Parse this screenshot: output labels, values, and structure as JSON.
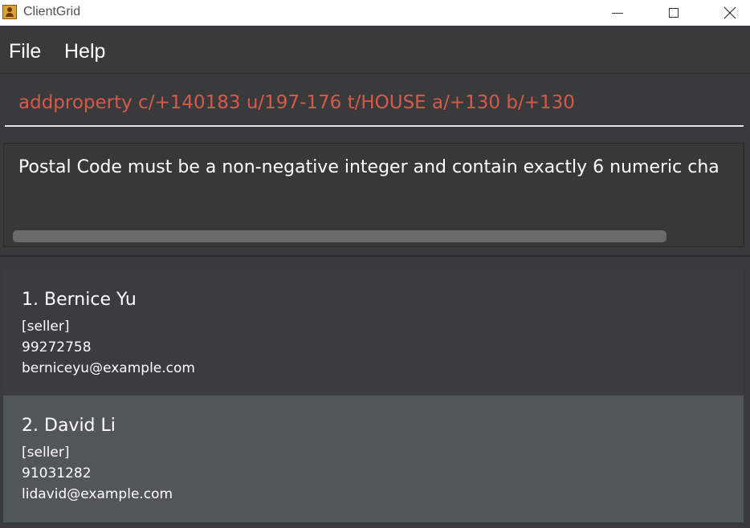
{
  "window": {
    "title": "ClientGrid"
  },
  "menubar": {
    "items": [
      {
        "label": "File"
      },
      {
        "label": "Help"
      }
    ]
  },
  "command_box": {
    "value": "addproperty c/+140183 u/197-176 t/HOUSE a/+130 b/+130",
    "text_color": "#d45a4a"
  },
  "result_display": {
    "text": "Postal Code must be a non-negative integer and contain exactly 6 numeric cha"
  },
  "persons": [
    {
      "index": "1.",
      "name": "Bernice Yu",
      "tag": "[seller]",
      "phone": "99272758",
      "email": "berniceyu@example.com"
    },
    {
      "index": "2.",
      "name": "David Li",
      "tag": "[seller]",
      "phone": "91031282",
      "email": "lidavid@example.com"
    }
  ],
  "colors": {
    "background": "#3a3a3c",
    "card_odd": "#3b3c3f",
    "card_selected": "#515658",
    "error_text": "#d45a4a"
  }
}
